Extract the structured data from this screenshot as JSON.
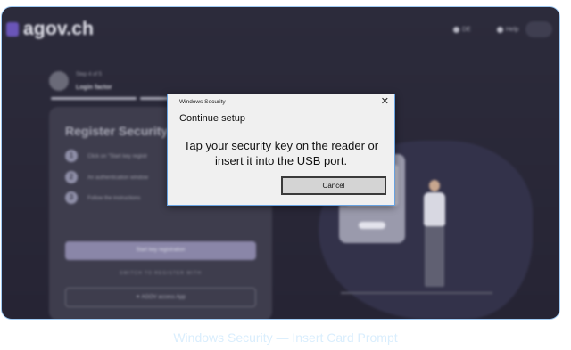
{
  "background_page": {
    "logo_text": "agov.ch",
    "header": {
      "language": "DE",
      "help": "Help"
    },
    "step": {
      "counter": "Step 4 of 5",
      "label": "Login factor"
    },
    "card": {
      "title": "Register  Security K",
      "steps": [
        {
          "number": "1",
          "text": "Click on \"Start key registr"
        },
        {
          "number": "2",
          "text": "An authentication window"
        },
        {
          "number": "3",
          "text": "Follow the instructions"
        }
      ],
      "primary_button": "Start key registration",
      "switch_text": "SWITCH TO REGISTER WITH",
      "alt_button": "✦ AGOV access App"
    }
  },
  "dialog": {
    "caption": "Windows Security",
    "close_glyph": "✕",
    "title": "Continue setup",
    "message_line1": "Tap your security key on the reader or",
    "message_line2": "insert it into the USB port.",
    "cancel_label": "Cancel"
  },
  "figure_caption": "Windows Security — Insert Card Prompt",
  "colors": {
    "frame_border": "#9fc9f2",
    "dialog_border": "#68a2e0",
    "caption": "#daeefd",
    "brand": "#6a55b8"
  }
}
